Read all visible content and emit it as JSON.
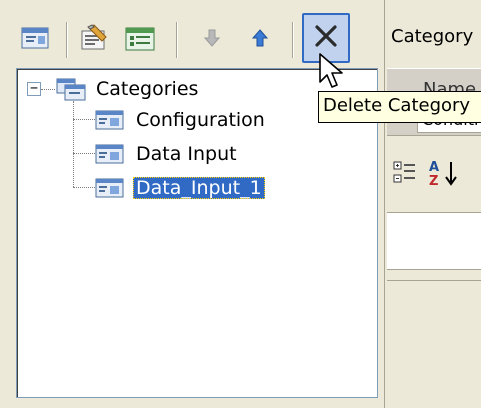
{
  "toolbar": {
    "buttons": [
      {
        "name": "category-view-icon"
      },
      {
        "name": "properties-icon"
      },
      {
        "name": "add-category-icon"
      },
      {
        "name": "move-down-icon"
      },
      {
        "name": "move-up-icon"
      },
      {
        "name": "delete-category-icon"
      }
    ],
    "tooltip": "Delete Category"
  },
  "tree": {
    "root": {
      "label": "Categories",
      "expander": "−"
    },
    "items": [
      {
        "label": "Configuration",
        "selected": false
      },
      {
        "label": "Data Input",
        "selected": false
      },
      {
        "label": "Data_Input_1",
        "selected": true
      }
    ]
  },
  "right_panel": {
    "title": "Category",
    "grid_header": "Name",
    "grid_value": "Conditi"
  },
  "colors": {
    "selection": "#316ac5",
    "window_bg": "#ece9d8",
    "tooltip_bg": "#ffffe1"
  }
}
